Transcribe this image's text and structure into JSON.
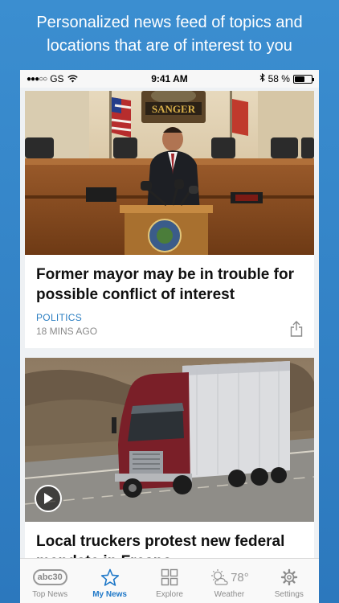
{
  "promo": {
    "caption": "Personalized news feed of topics and locations that are of interest to you"
  },
  "status_bar": {
    "carrier": "GS",
    "time": "9:41 AM",
    "battery": "58 %",
    "battery_level": 0.58
  },
  "feed": {
    "cards": [
      {
        "headline": "Former mayor may be in trouble for possible conflict of interest",
        "category": "POLITICS",
        "time": "18 MINS AGO",
        "image_sign": "SANGER"
      },
      {
        "headline": "Local truckers protest new federal mandate in Fresno"
      }
    ]
  },
  "tab_bar": {
    "tabs": [
      {
        "label": "Top News",
        "icon": "abc30-logo-icon",
        "logo_text": "abc30"
      },
      {
        "label": "My News",
        "icon": "star-icon",
        "active": true
      },
      {
        "label": "Explore",
        "icon": "grid-icon"
      },
      {
        "label": "Weather",
        "icon": "partly-sunny-icon",
        "temp": "78°"
      },
      {
        "label": "Settings",
        "icon": "gear-icon"
      }
    ]
  },
  "colors": {
    "accent": "#1f78c8",
    "background": "#2c78bd"
  }
}
